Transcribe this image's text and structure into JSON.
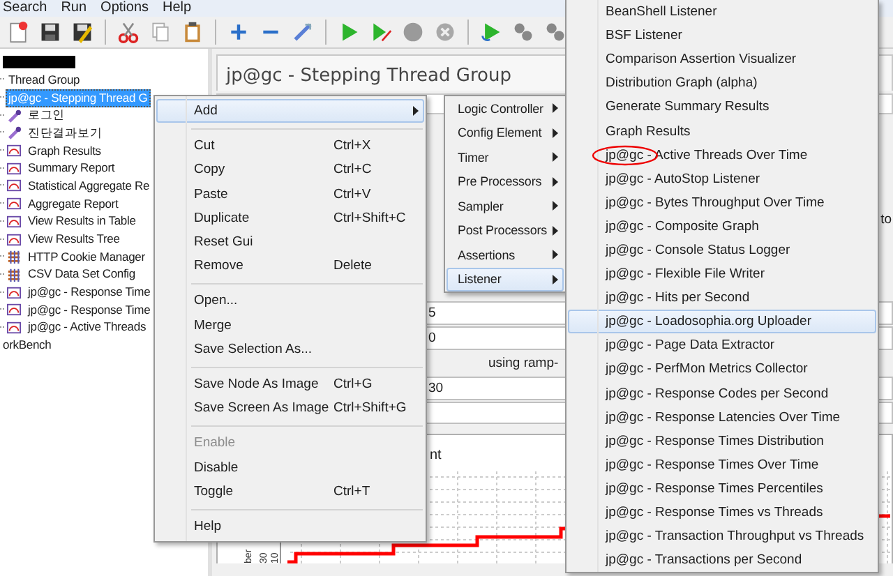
{
  "menu_bar": [
    "Search",
    "Run",
    "Options",
    "Help"
  ],
  "tree": {
    "items": [
      {
        "label": "Thread Group",
        "kind": "plain",
        "selected": false
      },
      {
        "label": "jp@gc - Stepping Thread G",
        "kind": "plain",
        "selected": true
      },
      {
        "label": "로그인",
        "kind": "sampler",
        "selected": false
      },
      {
        "label": "진단결과보기",
        "kind": "sampler",
        "selected": false
      },
      {
        "label": "Graph Results",
        "kind": "listener",
        "selected": false
      },
      {
        "label": "Summary Report",
        "kind": "listener",
        "selected": false
      },
      {
        "label": "Statistical Aggregate Re",
        "kind": "listener",
        "selected": false
      },
      {
        "label": "Aggregate Report",
        "kind": "listener",
        "selected": false
      },
      {
        "label": "View Results in Table",
        "kind": "listener",
        "selected": false
      },
      {
        "label": "View Results Tree",
        "kind": "listener",
        "selected": false
      },
      {
        "label": "HTTP Cookie Manager",
        "kind": "config",
        "selected": false
      },
      {
        "label": "CSV Data Set Config",
        "kind": "config",
        "selected": false
      },
      {
        "label": "jp@gc - Response Time",
        "kind": "listener",
        "selected": false
      },
      {
        "label": "jp@gc - Response Time",
        "kind": "listener",
        "selected": false
      },
      {
        "label": "jp@gc - Active Threads",
        "kind": "listener",
        "selected": false
      },
      {
        "label": "orkBench",
        "kind": "none",
        "selected": false
      }
    ]
  },
  "panel": {
    "title": "jp@gc - Stepping Thread Group",
    "side_label": "to",
    "field_values": [
      "5",
      "0"
    ],
    "ramp_label": "using ramp-",
    "field_values_2": [
      "30"
    ],
    "chart": {
      "title": "nt",
      "y_axis_label": "ber",
      "y_tick_labels": [
        "10",
        "30"
      ]
    }
  },
  "context_menu": {
    "groups": [
      [
        {
          "label": "Add",
          "disabled": false,
          "selected": true,
          "submenu": true
        }
      ],
      [
        {
          "label": "Cut",
          "shortcut": "Ctrl+X",
          "disabled": false,
          "selected": false,
          "submenu": false
        },
        {
          "label": "Copy",
          "shortcut": "Ctrl+C",
          "disabled": false,
          "selected": false,
          "submenu": false
        },
        {
          "label": "Paste",
          "shortcut": "Ctrl+V",
          "disabled": false,
          "selected": false,
          "submenu": false
        },
        {
          "label": "Duplicate",
          "shortcut": "Ctrl+Shift+C",
          "disabled": false,
          "selected": false,
          "submenu": false
        },
        {
          "label": "Reset Gui",
          "disabled": false,
          "selected": false,
          "submenu": false
        },
        {
          "label": "Remove",
          "shortcut": "Delete",
          "disabled": false,
          "selected": false,
          "submenu": false
        }
      ],
      [
        {
          "label": "Open...",
          "disabled": false,
          "selected": false,
          "submenu": false
        },
        {
          "label": "Merge",
          "disabled": false,
          "selected": false,
          "submenu": false
        },
        {
          "label": "Save Selection As...",
          "disabled": false,
          "selected": false,
          "submenu": false
        }
      ],
      [
        {
          "label": "Save Node As Image",
          "shortcut": "Ctrl+G",
          "disabled": false,
          "selected": false,
          "submenu": false
        },
        {
          "label": "Save Screen As Image",
          "shortcut": "Ctrl+Shift+G",
          "disabled": false,
          "selected": false,
          "submenu": false
        }
      ],
      [
        {
          "label": "Enable",
          "disabled": true,
          "selected": false,
          "submenu": false
        },
        {
          "label": "Disable",
          "disabled": false,
          "selected": false,
          "submenu": false
        },
        {
          "label": "Toggle",
          "shortcut": "Ctrl+T",
          "disabled": false,
          "selected": false,
          "submenu": false
        }
      ],
      [
        {
          "label": "Help",
          "disabled": false,
          "selected": false,
          "submenu": false
        }
      ]
    ]
  },
  "add_menu": {
    "items": [
      {
        "label": "Logic Controller",
        "selected": false
      },
      {
        "label": "Config Element",
        "selected": false
      },
      {
        "label": "Timer",
        "selected": false
      },
      {
        "label": "Pre Processors",
        "selected": false
      },
      {
        "label": "Sampler",
        "selected": false
      },
      {
        "label": "Post Processors",
        "selected": false
      },
      {
        "label": "Assertions",
        "selected": false
      },
      {
        "label": "Listener",
        "selected": true
      }
    ]
  },
  "listener_menu": {
    "items": [
      {
        "label": "BeanShell Listener",
        "selected": false,
        "circled": false
      },
      {
        "label": "BSF Listener",
        "selected": false,
        "circled": false
      },
      {
        "label": "Comparison Assertion Visualizer",
        "selected": false,
        "circled": false
      },
      {
        "label": "Distribution Graph (alpha)",
        "selected": false,
        "circled": false
      },
      {
        "label": "Generate Summary Results",
        "selected": false,
        "circled": false
      },
      {
        "label": "Graph Results",
        "selected": false,
        "circled": false
      },
      {
        "label": "jp@gc - Active Threads Over Time",
        "selected": false,
        "circled": true
      },
      {
        "label": "jp@gc - AutoStop Listener",
        "selected": false,
        "circled": false
      },
      {
        "label": "jp@gc - Bytes Throughput Over Time",
        "selected": false,
        "circled": false
      },
      {
        "label": "jp@gc - Composite Graph",
        "selected": false,
        "circled": false
      },
      {
        "label": "jp@gc - Console Status Logger",
        "selected": false,
        "circled": false
      },
      {
        "label": "jp@gc - Flexible File Writer",
        "selected": false,
        "circled": false
      },
      {
        "label": "jp@gc - Hits per Second",
        "selected": false,
        "circled": false
      },
      {
        "label": "jp@gc - Loadosophia.org Uploader",
        "selected": true,
        "circled": false
      },
      {
        "label": "jp@gc - Page Data Extractor",
        "selected": false,
        "circled": false
      },
      {
        "label": "jp@gc - PerfMon Metrics Collector",
        "selected": false,
        "circled": false
      },
      {
        "label": "jp@gc - Response Codes per Second",
        "selected": false,
        "circled": false
      },
      {
        "label": "jp@gc - Response Latencies Over Time",
        "selected": false,
        "circled": false
      },
      {
        "label": "jp@gc - Response Times Distribution",
        "selected": false,
        "circled": false
      },
      {
        "label": "jp@gc - Response Times Over Time",
        "selected": false,
        "circled": false
      },
      {
        "label": "jp@gc - Response Times Percentiles",
        "selected": false,
        "circled": false
      },
      {
        "label": "jp@gc - Response Times vs Threads",
        "selected": false,
        "circled": false
      },
      {
        "label": "jp@gc - Transaction Throughput vs Threads",
        "selected": false,
        "circled": false
      },
      {
        "label": "jp@gc - Transactions per Second",
        "selected": false,
        "circled": false
      }
    ]
  }
}
